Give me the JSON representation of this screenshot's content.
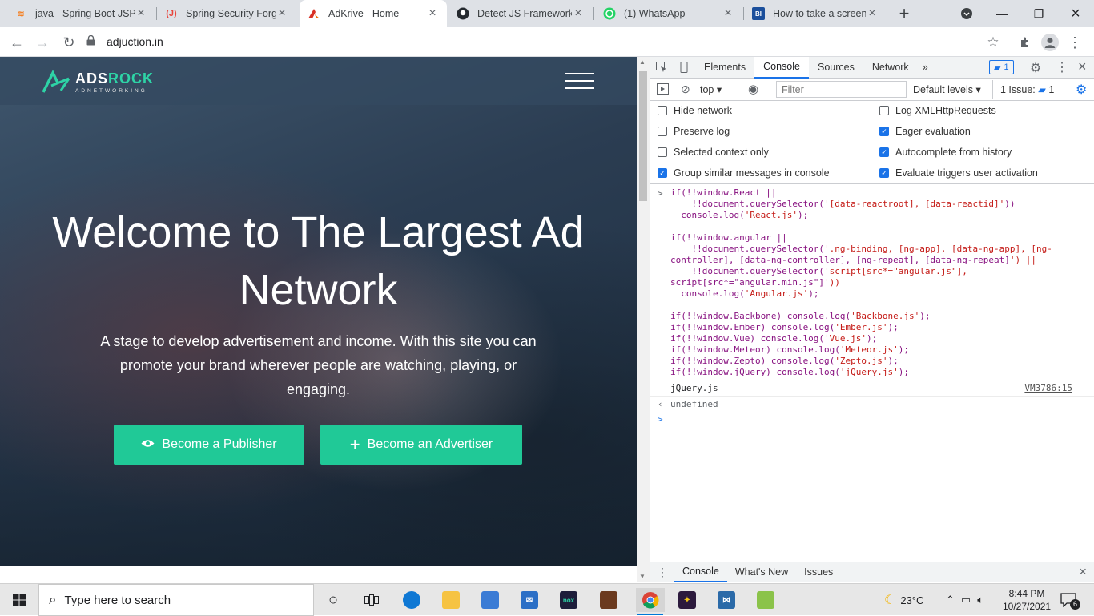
{
  "browser": {
    "tabs": [
      {
        "title": "java - Spring Boot JSP",
        "icon": "stackoverflow-icon",
        "color": "#f48024"
      },
      {
        "title": "Spring Security Forgot",
        "icon": "javaguides-icon",
        "color": "#e8453c"
      },
      {
        "title": "AdKrive - Home",
        "icon": "adkrive-icon",
        "color": "#d93025"
      },
      {
        "title": "Detect JS Framework u",
        "icon": "github-icon",
        "color": "#24292e"
      },
      {
        "title": "(1) WhatsApp",
        "icon": "whatsapp-icon",
        "color": "#25d366"
      },
      {
        "title": "How to take a screens",
        "icon": "bi-icon",
        "color": "#1b4f9c"
      }
    ],
    "url": "adjuction.in"
  },
  "site": {
    "brand_a": "ADS",
    "brand_b": "ROCK",
    "brand_sub": "ADNETWORKING",
    "hero_title": "Welcome to The Largest Ad Network",
    "hero_subtitle": "A stage to develop advertisement and income. With this site you can promote your brand wherever people are watching, playing, or engaging.",
    "publisher_btn": "Become a Publisher",
    "advertiser_btn": "Become an Advertiser",
    "accent": "#20c997"
  },
  "devtools": {
    "tabs": [
      "Elements",
      "Console",
      "Sources",
      "Network"
    ],
    "active_tab": "Console",
    "issues_badge": "1",
    "context": "top",
    "filter_placeholder": "Filter",
    "levels": "Default levels",
    "issues_label": "1 Issue:",
    "issues_count": "1",
    "settings": [
      {
        "label": "Hide network",
        "checked": false
      },
      {
        "label": "Log XMLHttpRequests",
        "checked": false
      },
      {
        "label": "Preserve log",
        "checked": false
      },
      {
        "label": "Eager evaluation",
        "checked": true
      },
      {
        "label": "Selected context only",
        "checked": false
      },
      {
        "label": "Autocomplete from history",
        "checked": true
      },
      {
        "label": "Group similar messages in console",
        "checked": true
      },
      {
        "label": "Evaluate triggers user activation",
        "checked": true
      }
    ],
    "code_lines": [
      "if(!!window.React ||",
      "    !!document.querySelector('[data-reactroot], [data-reactid]'))",
      "  console.log('React.js');",
      "",
      "if(!!window.angular ||",
      "    !!document.querySelector('.ng-binding, [ng-app], [data-ng-app], [ng-",
      "controller], [data-ng-controller], [ng-repeat], [data-ng-repeat]') ||",
      "    !!document.querySelector('script[src*=\"angular.js\"],",
      "script[src*=\"angular.min.js\"]'))",
      "  console.log('Angular.js');",
      "",
      "if(!!window.Backbone) console.log('Backbone.js');",
      "if(!!window.Ember) console.log('Ember.js');",
      "if(!!window.Vue) console.log('Vue.js');",
      "if(!!window.Meteor) console.log('Meteor.js');",
      "if(!!window.Zepto) console.log('Zepto.js');",
      "if(!!window.jQuery) console.log('jQuery.js');"
    ],
    "log_output": "jQuery.js",
    "log_source": "VM3786:15",
    "return_value": "undefined",
    "drawer_tabs": [
      "Console",
      "What's New",
      "Issues"
    ]
  },
  "taskbar": {
    "search_placeholder": "Type here to search",
    "temperature": "23°C",
    "time": "8:44 PM",
    "date": "10/27/2021",
    "notifications": "6"
  }
}
